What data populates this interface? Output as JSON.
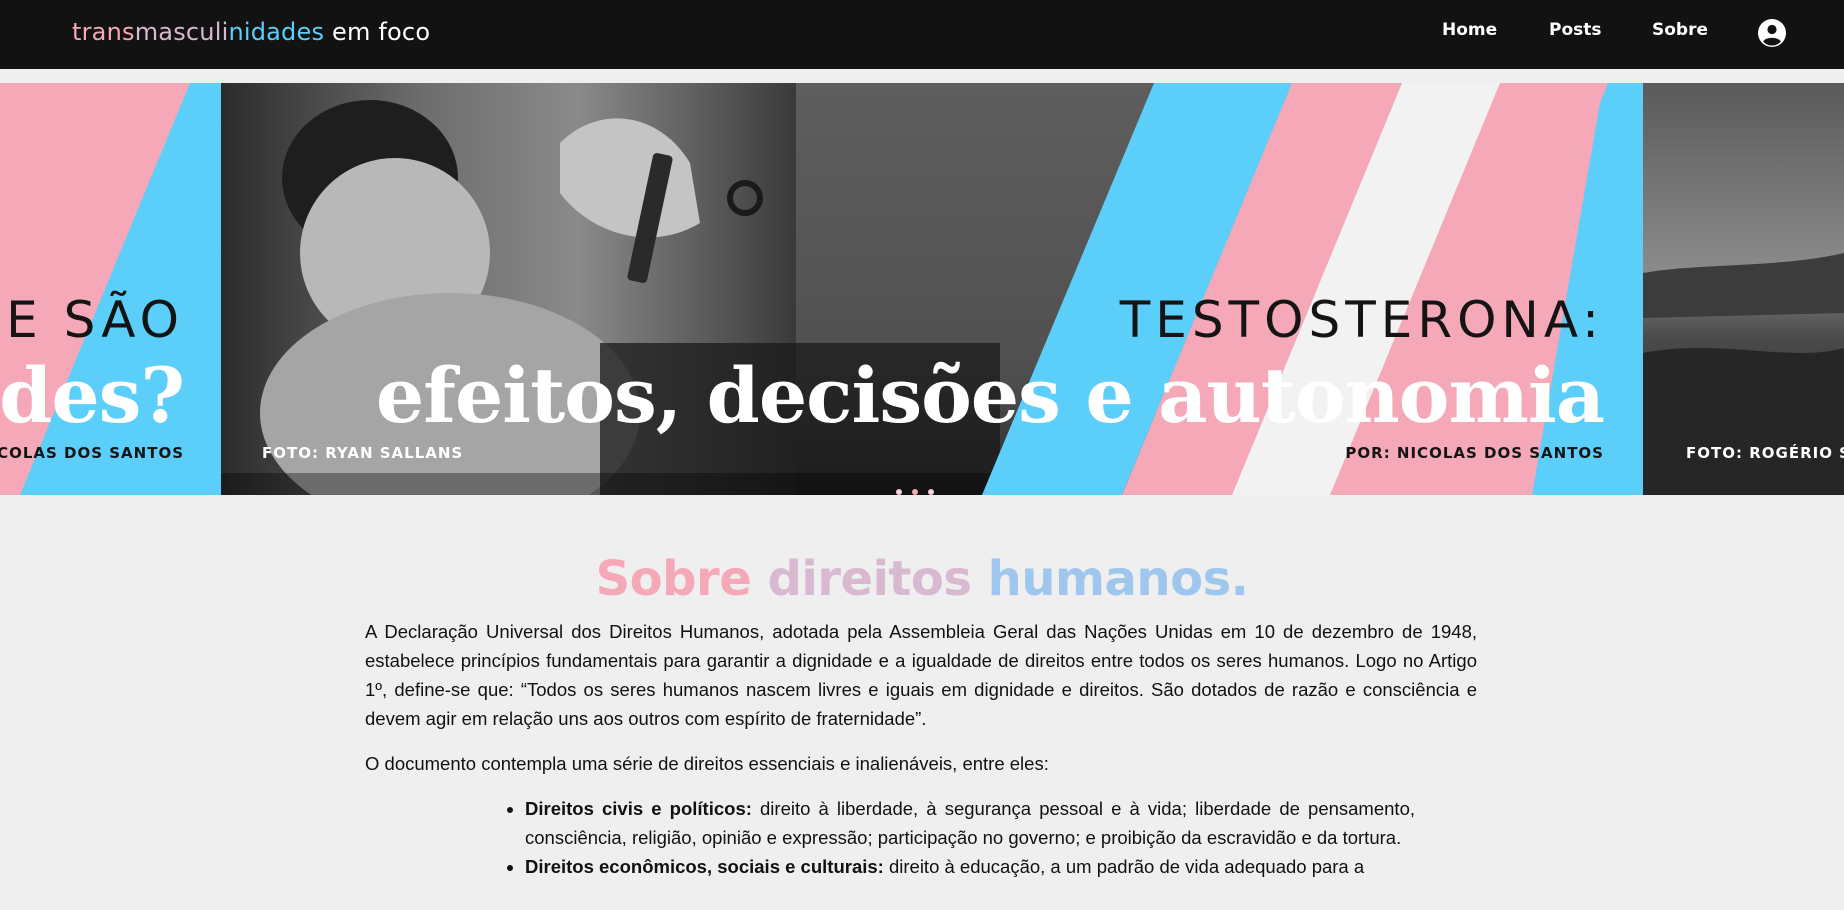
{
  "brand": {
    "part1": "transmasculinidades",
    "part2": "em foco",
    "colors": {
      "trans": "#f5a9b8",
      "masculi": "#d8b9cf",
      "nidades": "#5bcefa",
      "em_foco": "#ffffff"
    }
  },
  "nav": {
    "items": [
      {
        "label": "Home"
      },
      {
        "label": "Posts"
      },
      {
        "label": "Sobre"
      }
    ],
    "account_icon": "user-circle-icon"
  },
  "carousel": {
    "prev_slide": {
      "kicker": "UE SÃO",
      "headline": "des?",
      "credit": "ICOLAS DOS SANTOS"
    },
    "current_slide": {
      "kicker": "TESTOSTERONA:",
      "headline": "efeitos, decisões e autonomia",
      "photo_credit": "FOTO: RYAN SALLANS",
      "author_credit": "POR: NICOLAS DOS SANTOS"
    },
    "next_slide": {
      "photo_credit": "FOTO: ROGÉRIO SO"
    },
    "active_dot": 1,
    "dot_count": 3,
    "colors": {
      "pink": "#f5a9b8",
      "blue": "#5bcefa",
      "white": "#f2f2f2"
    }
  },
  "section": {
    "title_words": [
      "Sobre",
      "direitos",
      "humanos."
    ],
    "title_colors": [
      "#f5a9b8",
      "#d8b9cf",
      "#9fc6ec"
    ],
    "paragraphs": [
      "A Declaração Universal dos Direitos Humanos, adotada pela Assembleia Geral das Nações Unidas em 10 de dezembro de 1948, estabelece princípios fundamentais para garantir a dignidade e a igualdade de direitos entre todos os seres humanos. Logo no Artigo 1º, define-se que: “Todos os seres humanos nascem livres e iguais em dignidade e direitos. São dotados de razão e consciência e devem agir em relação uns aos outros com espírito de fraternidade”.",
      "O documento contempla uma série de direitos essenciais e inalienáveis, entre eles:"
    ],
    "list": [
      {
        "term": "Direitos civis e políticos:",
        "text": " direito à liberdade, à segurança pessoal e à vida; liberdade de pensamento, consciência, religião, opinião e expressão; participação no governo; e proibição da escravidão e da tortura."
      },
      {
        "term": "Direitos econômicos, sociais e culturais:",
        "text": " direito à educação, a um padrão de vida adequado para a"
      }
    ]
  }
}
